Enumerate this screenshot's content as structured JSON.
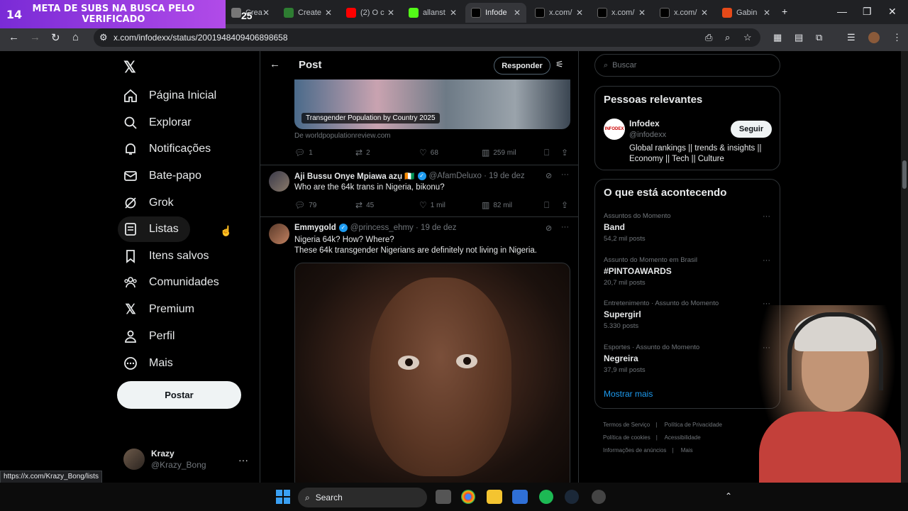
{
  "overlay": {
    "counter": "14",
    "banner": "META DE SUBS NA BUSCA PELO VERIFICADO",
    "badge": "25"
  },
  "browser": {
    "tabs": [
      {
        "label": "Crea",
        "color": "#777"
      },
      {
        "label": "Create",
        "color": "#2e7d32"
      },
      {
        "label": "(2) O c",
        "color": "#ff0000"
      },
      {
        "label": "allanst",
        "color": "#53fc18"
      },
      {
        "label": "Infode",
        "color": "#000000",
        "active": true
      },
      {
        "label": "x.com/",
        "color": "#000000"
      },
      {
        "label": "x.com/",
        "color": "#000000"
      },
      {
        "label": "x.com/",
        "color": "#000000"
      },
      {
        "label": "Gabin",
        "color": "#e64a19"
      }
    ],
    "url": "x.com/infodexx/status/2001948409406898658",
    "status_url": "https://x.com/Krazy_Bong/lists"
  },
  "sidebar": {
    "items": [
      {
        "label": "Página Inicial",
        "icon": "home-icon"
      },
      {
        "label": "Explorar",
        "icon": "search-icon"
      },
      {
        "label": "Notificações",
        "icon": "bell-icon"
      },
      {
        "label": "Bate-papo",
        "icon": "mail-icon"
      },
      {
        "label": "Grok",
        "icon": "grok-icon"
      },
      {
        "label": "Listas",
        "icon": "list-icon"
      },
      {
        "label": "Itens salvos",
        "icon": "bookmark-icon"
      },
      {
        "label": "Comunidades",
        "icon": "people-icon"
      },
      {
        "label": "Premium",
        "icon": "x-icon"
      },
      {
        "label": "Perfil",
        "icon": "person-icon"
      },
      {
        "label": "Mais",
        "icon": "more-circle-icon"
      }
    ],
    "post_button": "Postar",
    "profile": {
      "name": "Krazy",
      "handle": "@Krazy_Bong"
    }
  },
  "feed": {
    "title": "Post",
    "reply_button": "Responder",
    "media_caption": "Transgender Population by Country 2025",
    "media_source": "De worldpopulationreview.com",
    "main_actions": {
      "replies": "1",
      "reposts": "2",
      "likes": "68",
      "views": "259 mil"
    },
    "replies": [
      {
        "name": "Aji Bussu Onye Mpiawa azụ 🇨🇮",
        "handle": "@AfamDeluxo",
        "date": "19 de dez",
        "text": "Who are the 64k trans in Nigeria, bikonu?",
        "replies": "79",
        "reposts": "45",
        "likes": "1 mil",
        "views": "82 mil"
      },
      {
        "name": "Emmygold",
        "handle": "@princess_ehmy",
        "date": "19 de dez",
        "text_line1": "Nigeria 64k? How? Where?",
        "text_line2": "These 64k transgender Nigerians are definitely not living in Nigeria."
      }
    ]
  },
  "right": {
    "search_placeholder": "Buscar",
    "relevant": {
      "title": "Pessoas relevantes",
      "name": "Infodex",
      "handle": "@infodexx",
      "avatar_text": "INFODEX",
      "follow": "Seguir",
      "bio": "Global rankings || trends & insights || Economy || Tech || Culture"
    },
    "trends": {
      "title": "O que está acontecendo",
      "items": [
        {
          "meta": "Assuntos do Momento",
          "name": "Band",
          "count": "54,2 mil posts"
        },
        {
          "meta": "Assunto do Momento em Brasil",
          "name": "#PINTOAWARDS",
          "count": "20,7 mil posts"
        },
        {
          "meta": "Entretenimento · Assunto do Momento",
          "name": "Supergirl",
          "count": "5.330 posts"
        },
        {
          "meta": "Esportes · Assunto do Momento",
          "name": "Negreira",
          "count": "37,9 mil posts"
        }
      ],
      "show_more": "Mostrar mais"
    },
    "footer": [
      "Termos de Serviço",
      "Política de Privacidade",
      "Política de cookies",
      "Acessibilidade",
      "Informações de anúncios",
      "Mais"
    ]
  },
  "taskbar": {
    "search": "Search"
  }
}
